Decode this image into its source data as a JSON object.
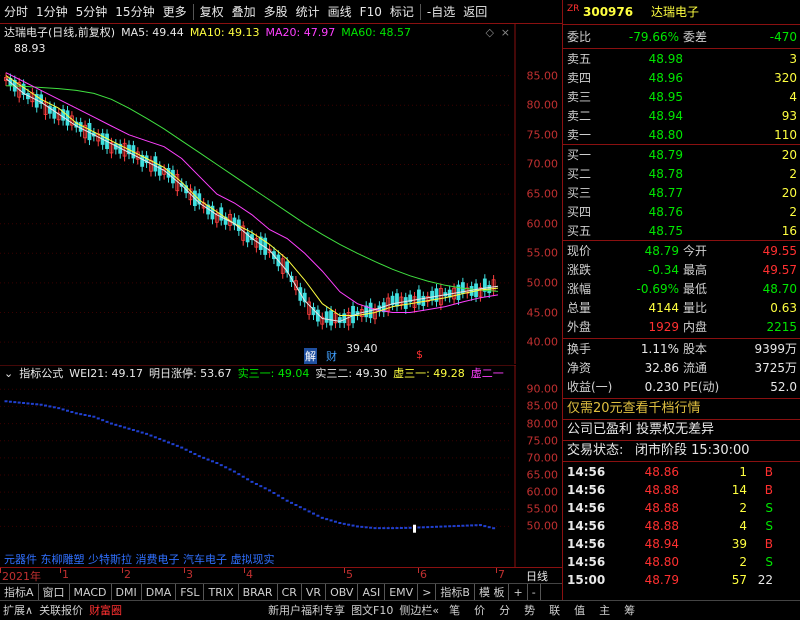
{
  "toolbar": {
    "items": [
      "分时",
      "1分钟",
      "5分钟",
      "15分钟",
      "更多",
      "复权",
      "叠加",
      "多股",
      "统计",
      "画线",
      "F10",
      "标记",
      "-自选",
      "返回"
    ]
  },
  "main_chart": {
    "stock_label": "达瑞电子(日线,前复权)",
    "ma5": "MA5: 49.44",
    "ma10": "MA10: 49.13",
    "ma20": "MA20: 47.97",
    "ma60": "MA60: 48.57",
    "high_marker": "88.93",
    "low_marker": "39.40",
    "mark_jie": "解",
    "mark_cai": "财",
    "mark_s": "$",
    "colors": {
      "ma5": "#e8e8e8",
      "ma10": "#ffff40",
      "ma20": "#ff40ff",
      "ma60": "#40e040",
      "up": "#ff4040",
      "down": "#40e0e0"
    }
  },
  "sub_chart": {
    "title": "指标公式",
    "wei": "WEI21: 49.17",
    "zt": "明日涨停: 53.67",
    "s1": "实三一: 49.04",
    "s2": "实三二: 49.30",
    "x1": "虚三一: 49.28",
    "x2": "虚二一",
    "footer_text": "元器件 东柳雕塑 少特斯拉 消费电子 汽车电子 虚拟现实"
  },
  "chart_data": [
    {
      "type": "line",
      "title": "达瑞电子(日线,前复权)",
      "ylim": [
        38,
        90
      ],
      "yticks": [
        40.0,
        45.0,
        50.0,
        55.0,
        60.0,
        65.0,
        70.0,
        75.0,
        80.0,
        85.0
      ],
      "series": [
        {
          "name": "MA60",
          "values": [
            83.3,
            83.2,
            83.0,
            82.8,
            82.5,
            82.0,
            81.0,
            79.5,
            77.8,
            76.0,
            74.0,
            72.0,
            70.0,
            68.0,
            66.0,
            64.0,
            62.0,
            60.0,
            58.2,
            56.5,
            55.0,
            53.6,
            52.3,
            51.2,
            50.3,
            49.6,
            49.1,
            48.8,
            48.57
          ]
        },
        {
          "name": "MA20",
          "values": [
            85.5,
            84.0,
            82.5,
            81.0,
            79.5,
            78.0,
            76.5,
            75.0,
            74.0,
            73.0,
            71.0,
            68.0,
            65.0,
            63.5,
            61.5,
            59.0,
            57.5,
            55.0,
            52.0,
            48.5,
            46.5,
            45.5,
            45.0,
            45.0,
            45.5,
            46.0,
            46.8,
            47.5,
            47.97
          ]
        },
        {
          "name": "MA10",
          "values": [
            85.0,
            83.0,
            81.0,
            79.5,
            77.0,
            75.5,
            74.0,
            72.5,
            71.0,
            69.5,
            67.0,
            64.0,
            62.0,
            60.0,
            58.5,
            56.5,
            54.0,
            50.5,
            46.5,
            44.5,
            44.5,
            45.0,
            46.0,
            46.5,
            47.0,
            47.5,
            48.2,
            48.8,
            49.13
          ]
        },
        {
          "name": "MA5",
          "values": [
            84.5,
            82.0,
            80.5,
            78.5,
            76.5,
            75.0,
            73.5,
            72.0,
            70.5,
            69.0,
            66.5,
            63.5,
            61.5,
            60.0,
            57.5,
            55.5,
            52.0,
            47.0,
            44.0,
            43.5,
            44.8,
            45.5,
            46.5,
            47.0,
            47.5,
            48.0,
            48.5,
            49.0,
            49.44
          ]
        }
      ]
    },
    {
      "type": "scatter",
      "title": "指标公式",
      "ylim": [
        44,
        93
      ],
      "yticks": [
        50.0,
        55.0,
        60.0,
        65.0,
        70.0,
        75.0,
        80.0,
        85.0,
        90.0
      ],
      "series": [
        {
          "name": "WEI21",
          "values": [
            86.5,
            86.0,
            85.5,
            84.5,
            83.0,
            82.0,
            80.0,
            78.5,
            77.0,
            75.0,
            73.0,
            70.5,
            68.5,
            66.0,
            63.0,
            60.5,
            57.5,
            55.0,
            52.5,
            51.0,
            50.0,
            49.5,
            49.5,
            49.6,
            49.8,
            50.0,
            50.2,
            50.4,
            49.17
          ]
        }
      ]
    }
  ],
  "date_axis": {
    "labels": [
      "2021年",
      "1",
      "2",
      "3",
      "4",
      "5",
      "6",
      "7"
    ],
    "right": "日线"
  },
  "tabs": [
    "指标A",
    "窗口",
    "MACD",
    "DMI",
    "DMA",
    "FSL",
    "TRIX",
    "BRAR",
    "CR",
    "VR",
    "OBV",
    "ASI",
    "EMV",
    ">",
    "指标B",
    "模 板",
    "+",
    "-"
  ],
  "status": [
    "扩展∧",
    "关联报价",
    "财富圈",
    "新用户福利专享",
    "图文F10",
    "侧边栏«",
    "笔",
    "价",
    "分",
    "势",
    "联",
    "值",
    "主",
    "筹"
  ],
  "quote": {
    "tag": "ZR",
    "code": "300976",
    "name": "达瑞电子",
    "weibi_label": "委比",
    "weibi": "-79.66%",
    "weicha_label": "委差",
    "weicha": "-470",
    "asks": [
      {
        "label": "卖五",
        "price": "48.98",
        "vol": "3"
      },
      {
        "label": "卖四",
        "price": "48.96",
        "vol": "320"
      },
      {
        "label": "卖三",
        "price": "48.95",
        "vol": "4"
      },
      {
        "label": "卖二",
        "price": "48.94",
        "vol": "93"
      },
      {
        "label": "卖一",
        "price": "48.80",
        "vol": "110"
      }
    ],
    "bids": [
      {
        "label": "买一",
        "price": "48.79",
        "vol": "20"
      },
      {
        "label": "买二",
        "price": "48.78",
        "vol": "2"
      },
      {
        "label": "买三",
        "price": "48.77",
        "vor": "",
        "vol": "20"
      },
      {
        "label": "买四",
        "price": "48.76",
        "vol": "2"
      },
      {
        "label": "买五",
        "price": "48.75",
        "vol": "16"
      }
    ],
    "stats": [
      {
        "l1": "现价",
        "v1": "48.79",
        "c1": "green",
        "l2": "今开",
        "v2": "49.55",
        "c2": "red"
      },
      {
        "l1": "涨跌",
        "v1": "-0.34",
        "c1": "green",
        "l2": "最高",
        "v2": "49.57",
        "c2": "red"
      },
      {
        "l1": "涨幅",
        "v1": "-0.69%",
        "c1": "green",
        "l2": "最低",
        "v2": "48.70",
        "c2": "green"
      },
      {
        "l1": "总量",
        "v1": "4144",
        "c1": "yellow",
        "l2": "量比",
        "v2": "0.63",
        "c2": "yellow"
      },
      {
        "l1": "外盘",
        "v1": "1929",
        "c1": "red",
        "l2": "内盘",
        "v2": "2215",
        "c2": "green"
      }
    ],
    "stats2": [
      {
        "l1": "换手",
        "v1": "1.11%",
        "l2": "股本",
        "v2": "9399万"
      },
      {
        "l1": "净资",
        "v1": "32.86",
        "l2": "流通",
        "v2": "3725万"
      },
      {
        "l1": "收益(一)",
        "v1": "0.230",
        "l2": "PE(动)",
        "v2": "52.0"
      }
    ],
    "promo": "仅需20元查看千档行情",
    "note": "公司已盈利 投票权无差异",
    "trade_status_label": "交易状态:",
    "trade_status": "闭市阶段 15:30:00",
    "ticks": [
      {
        "t": "14:56",
        "p": "48.86",
        "v": "1",
        "bs": "B"
      },
      {
        "t": "14:56",
        "p": "48.88",
        "v": "14",
        "bs": "B"
      },
      {
        "t": "14:56",
        "p": "48.88",
        "v": "2",
        "bs": "S"
      },
      {
        "t": "14:56",
        "p": "48.88",
        "v": "4",
        "bs": "S"
      },
      {
        "t": "14:56",
        "p": "48.94",
        "v": "39",
        "bs": "B"
      },
      {
        "t": "14:56",
        "p": "48.80",
        "v": "2",
        "bs": "S"
      },
      {
        "t": "15:00",
        "p": "48.79",
        "v": "57",
        "bs": "22"
      }
    ]
  }
}
